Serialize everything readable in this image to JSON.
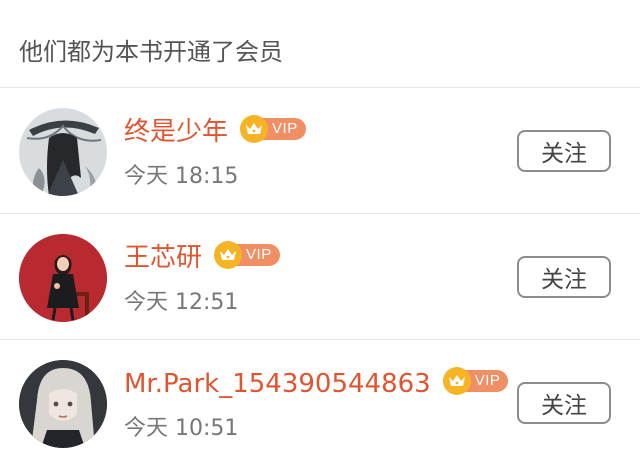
{
  "header": {
    "title": "他们都为本书开通了会员"
  },
  "members": [
    {
      "name": "终是少年",
      "badge": "VIP",
      "time": "今天 18:15",
      "follow_label": "关注"
    },
    {
      "name": "王芯研",
      "badge": "VIP",
      "time": "今天 12:51",
      "follow_label": "关注"
    },
    {
      "name": "Mr.Park_154390544863",
      "badge": "VIP",
      "time": "今天 10:51",
      "follow_label": "关注"
    }
  ],
  "colors": {
    "username": "#e0552f",
    "crown": "#f6b424",
    "vip_badge": "#f08f64",
    "divider": "#e7e7e7",
    "button_border": "#8c8c8c"
  },
  "icons": {
    "badge_icon": "crown-icon"
  }
}
